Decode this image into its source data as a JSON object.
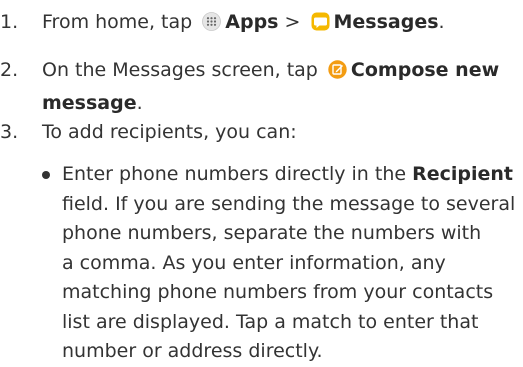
{
  "steps": [
    {
      "number": "1.",
      "parts": {
        "a": "From home, tap",
        "apps": "Apps",
        "sep": ">",
        "messages": "Messages",
        "end": "."
      }
    },
    {
      "number": "2.",
      "parts": {
        "a": "On the Messages screen, tap",
        "compose_1": "Compose new",
        "compose_2": "message",
        "end": "."
      }
    },
    {
      "number": "3.",
      "parts": {
        "a": "To add recipients, you can:"
      }
    }
  ],
  "bullet": {
    "l1_a": "Enter phone numbers directly in the",
    "l1_b": "Recipient",
    "l2": "field. If you are sending the message to several",
    "l3": "phone numbers, separate the numbers with",
    "l4": "a comma. As you enter information, any",
    "l5": "matching phone numbers from your contacts",
    "l6": "list are displayed. Tap a match to enter that",
    "l7": "number or address directly."
  },
  "icons": {
    "apps": "apps-grid-icon",
    "messages": "messages-app-icon",
    "compose": "compose-icon"
  },
  "colors": {
    "text": "#333333",
    "apps_icon_bg": "#e6e6e6",
    "messages_icon": "#f5b800",
    "compose_icon": "#f39c12"
  }
}
